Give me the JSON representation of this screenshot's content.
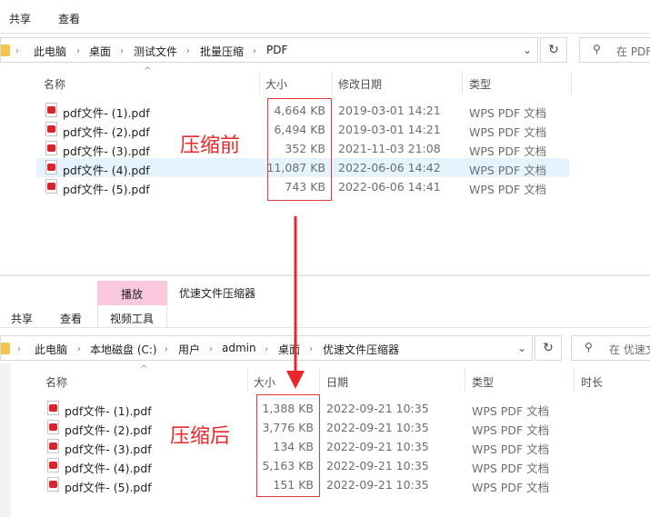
{
  "top": {
    "ribbon_tabs": [
      "共享",
      "查看"
    ],
    "address_path": [
      "此电脑",
      "桌面",
      "测试文件",
      "批量压缩",
      "PDF"
    ],
    "search_placeholder": "在 PDF",
    "columns": [
      "名称",
      "大小",
      "修改日期",
      "类型"
    ],
    "files": [
      {
        "name": "pdf文件- (1).pdf",
        "size": "4,664 KB",
        "date": "2019-03-01 14:21",
        "type": "WPS PDF 文档"
      },
      {
        "name": "pdf文件- (2).pdf",
        "size": "6,494 KB",
        "date": "2019-03-01 14:21",
        "type": "WPS PDF 文档"
      },
      {
        "name": "pdf文件- (3).pdf",
        "size": "352 KB",
        "date": "2021-11-03 21:08",
        "type": "WPS PDF 文档"
      },
      {
        "name": "pdf文件- (4).pdf",
        "size": "11,087 KB",
        "date": "2022-06-06 14:42",
        "type": "WPS PDF 文档"
      },
      {
        "name": "pdf文件- (5).pdf",
        "size": "743 KB",
        "date": "2022-06-06 14:41",
        "type": "WPS PDF 文档"
      }
    ],
    "annotation": "压缩前"
  },
  "bottom": {
    "ribbon_tabs": [
      "共享",
      "查看"
    ],
    "context_tab_group": "播放",
    "context_tab": "视频工具",
    "window_title": "优速文件压缩器",
    "address_path": [
      "此电脑",
      "本地磁盘 (C:)",
      "用户",
      "admin",
      "桌面",
      "优速文件压缩器"
    ],
    "search_placeholder": "在 优速文",
    "columns": [
      "名称",
      "大小",
      "日期",
      "类型",
      "时长"
    ],
    "files": [
      {
        "name": "pdf文件- (1).pdf",
        "size": "1,388 KB",
        "date": "2022-09-21 10:35",
        "type": "WPS PDF 文档"
      },
      {
        "name": "pdf文件- (2).pdf",
        "size": "3,776 KB",
        "date": "2022-09-21 10:35",
        "type": "WPS PDF 文档"
      },
      {
        "name": "pdf文件- (3).pdf",
        "size": "134 KB",
        "date": "2022-09-21 10:35",
        "type": "WPS PDF 文档"
      },
      {
        "name": "pdf文件- (4).pdf",
        "size": "5,163 KB",
        "date": "2022-09-21 10:35",
        "type": "WPS PDF 文档"
      },
      {
        "name": "pdf文件- (5).pdf",
        "size": "151 KB",
        "date": "2022-09-21 10:35",
        "type": "WPS PDF 文档"
      }
    ],
    "annotation": "压缩后"
  },
  "colors": {
    "selected_row": "#e5f3ff",
    "context_tab": "#f9c8dc",
    "annotation": "#e8262c"
  },
  "icons": {
    "folder": "folder-icon",
    "refresh": "refresh-icon",
    "search": "search-icon",
    "chevron": "chevron-down-icon",
    "file": "pdf-file-icon"
  }
}
